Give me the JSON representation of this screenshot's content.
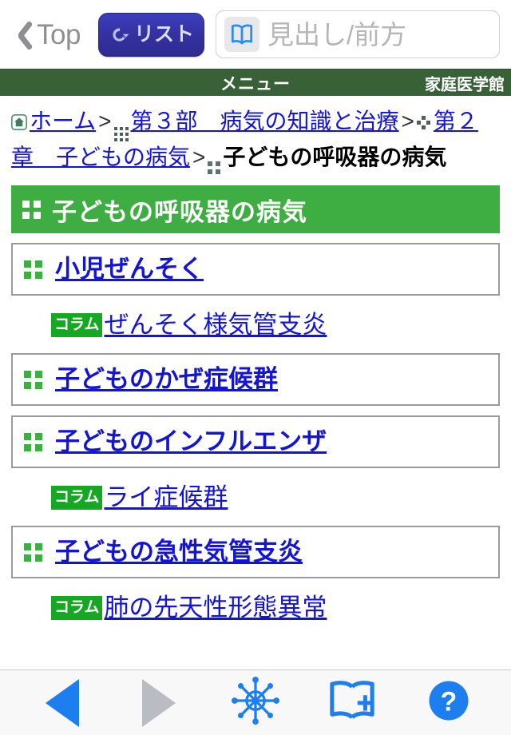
{
  "navbar": {
    "back_label": "Top",
    "back_icon": "chevron-left-icon",
    "list_button_label": "リスト",
    "list_button_icon": "return-arrow-icon",
    "search_icon": "open-book-icon",
    "search_value": "",
    "search_placeholder": "見出し/前方"
  },
  "menubar": {
    "menu_label": "メニュー",
    "dictionary_name": "家庭医学館"
  },
  "breadcrumb": {
    "items": [
      {
        "icon": "home-icon",
        "label": "ホーム",
        "link": true
      },
      {
        "icon": "grid-3x3-icon",
        "label": "第３部　病気の知識と治療",
        "link": true
      },
      {
        "icon": "diamond-dots-icon",
        "label": "第２章　子どもの病気",
        "link": true
      },
      {
        "icon": "grid-2x2-icon",
        "label": "子どもの呼吸器の病気",
        "link": false
      }
    ],
    "separator": ">"
  },
  "section": {
    "icon": "grid-2x2-icon",
    "title": "子どもの呼吸器の病気"
  },
  "entries": [
    {
      "type": "entry",
      "icon": "grid-2x2-icon",
      "label": "小児ぜんそく"
    },
    {
      "type": "column",
      "badge": "コラム",
      "label": "ぜんそく様気管支炎"
    },
    {
      "type": "entry",
      "icon": "grid-2x2-icon",
      "label": "子どものかぜ症候群"
    },
    {
      "type": "entry",
      "icon": "grid-2x2-icon",
      "label": "子どものインフルエンザ"
    },
    {
      "type": "column",
      "badge": "コラム",
      "label": "ライ症候群"
    },
    {
      "type": "entry",
      "icon": "grid-2x2-icon",
      "label": "子どもの急性気管支炎"
    },
    {
      "type": "column",
      "badge": "コラム",
      "label": "肺の先天性形態異常"
    }
  ],
  "toolbar": {
    "buttons": [
      {
        "name": "back-button",
        "icon": "triangle-left-icon",
        "state": "enabled"
      },
      {
        "name": "forward-button",
        "icon": "triangle-right-icon",
        "state": "disabled"
      },
      {
        "name": "helm-button",
        "icon": "ship-wheel-icon",
        "state": "enabled"
      },
      {
        "name": "add-bookmark-button",
        "icon": "book-plus-icon",
        "state": "enabled"
      },
      {
        "name": "help-button",
        "icon": "question-mark-icon",
        "state": "enabled"
      }
    ]
  },
  "colors": {
    "menubar_green": "#396138",
    "section_green": "#3eae43",
    "badge_green": "#16a822",
    "link_blue": "#1414d6",
    "accent_blue": "#1d7ef0",
    "list_button_blue": "#34309e"
  }
}
